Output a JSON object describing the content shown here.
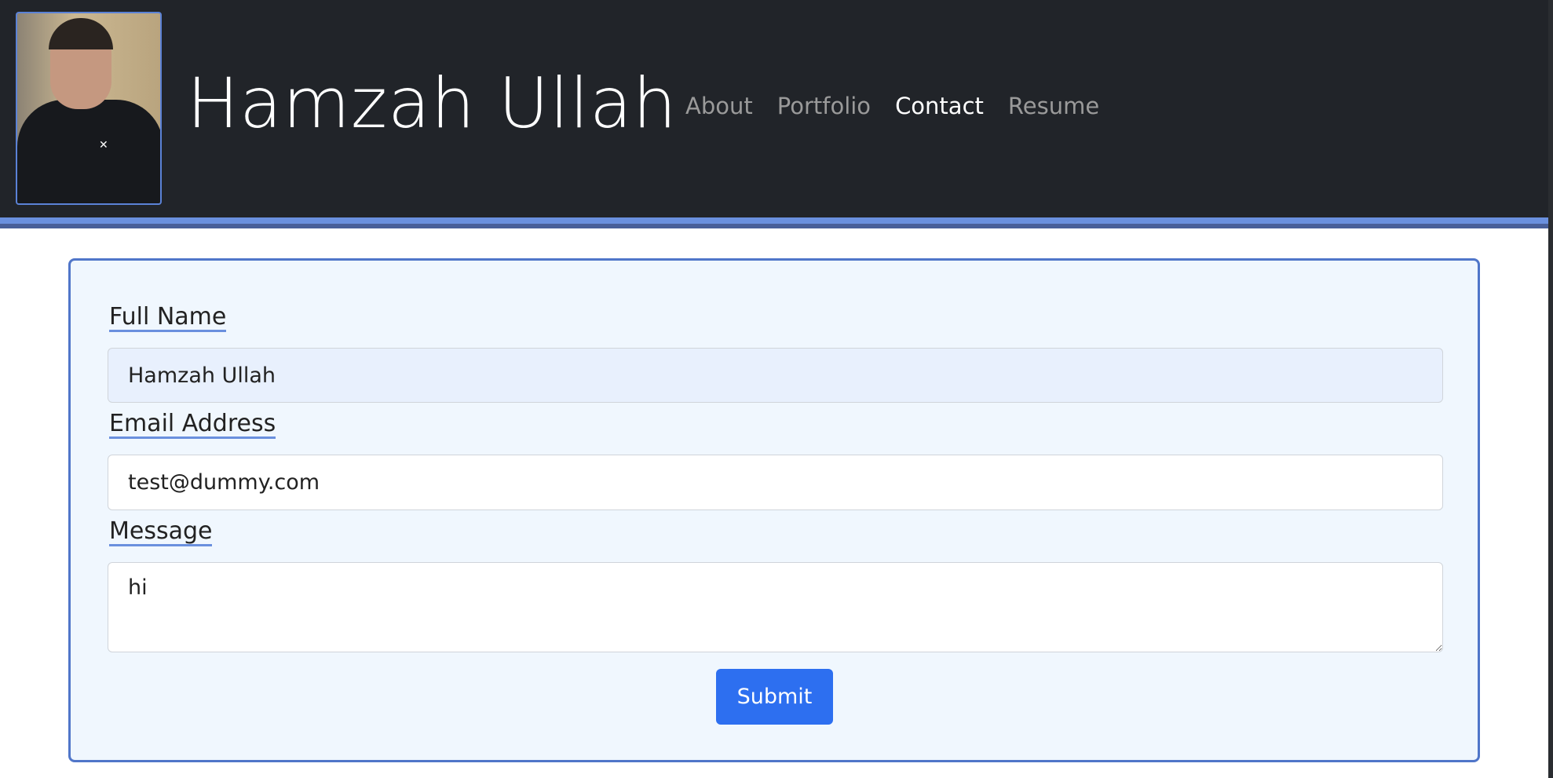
{
  "header": {
    "title": "Hamzah Ullah",
    "nav": [
      {
        "label": "About"
      },
      {
        "label": "Portfolio"
      },
      {
        "label": "Contact"
      },
      {
        "label": "Resume"
      }
    ]
  },
  "form": {
    "full_name": {
      "label": "Full Name",
      "value": "Hamzah Ullah"
    },
    "email": {
      "label": "Email Address",
      "value": "test@dummy.com"
    },
    "message": {
      "label": "Message",
      "value": "hi"
    },
    "submit": "Submit"
  }
}
